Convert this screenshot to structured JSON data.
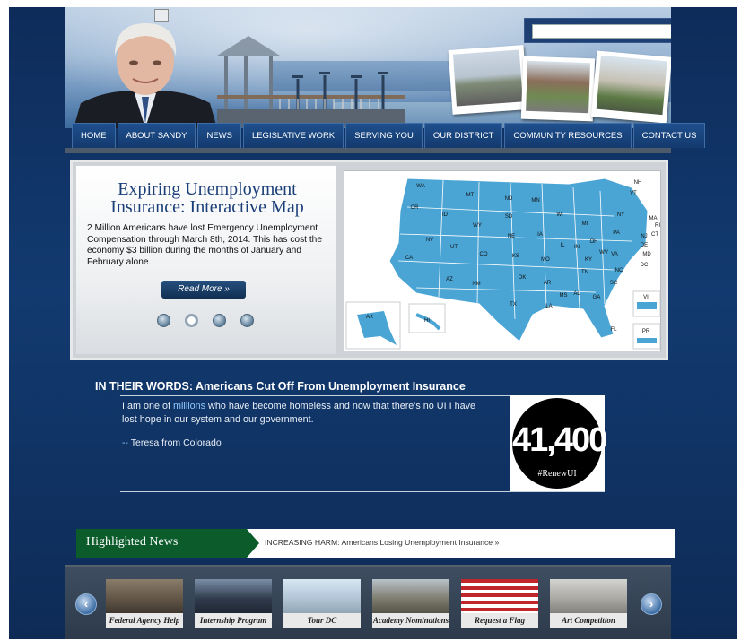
{
  "nav": {
    "items": [
      "HOME",
      "ABOUT SANDY",
      "NEWS",
      "LEGISLATIVE WORK",
      "SERVING YOU",
      "OUR DISTRICT",
      "COMMUNITY RESOURCES",
      "CONTACT US"
    ]
  },
  "search": {
    "value": ""
  },
  "slider": {
    "title": "Expiring Unemployment Insurance: Interactive Map",
    "body": "2 Million Americans have lost Emergency Unemployment Compensation through March 8th, 2014. This has cost the economy $3 billion during the months of January and February alone.",
    "button": "Read More »",
    "active_dot": 2,
    "map_labels": [
      "WA",
      "OR",
      "ID",
      "MT",
      "ND",
      "MN",
      "WI",
      "MI",
      "NY",
      "VT",
      "NH",
      "MA",
      "RI",
      "CT",
      "NJ",
      "DE",
      "MD",
      "DC",
      "CA",
      "NV",
      "UT",
      "WY",
      "SD",
      "NE",
      "IA",
      "IL",
      "IN",
      "OH",
      "PA",
      "WV",
      "VA",
      "NC",
      "AZ",
      "NM",
      "CO",
      "KS",
      "MO",
      "KY",
      "TN",
      "SC",
      "OK",
      "AR",
      "MS",
      "AL",
      "GA",
      "TX",
      "LA",
      "FL",
      "AK",
      "HI",
      "VI",
      "PR"
    ]
  },
  "quote": {
    "heading": "IN THEIR WORDS: Americans Cut Off From Unemployment Insurance",
    "text_pre": "I am one of ",
    "text_hl": "millions",
    "text_post": " who have become homeless and now that there's no UI I have lost hope in our system and our government.",
    "author_dash": "--",
    "author": " Teresa from Colorado",
    "badge_number": "41,400",
    "badge_tag": "#RenewUI"
  },
  "highlighted": {
    "label": "Highlighted News",
    "link": "INCREASING HARM: Americans Losing Unemployment Insurance »"
  },
  "carousel": {
    "tiles": [
      "Federal Agency Help",
      "Internship Program",
      "Tour DC",
      "Academy Nominations",
      "Request a Flag",
      "Art Competition"
    ]
  }
}
